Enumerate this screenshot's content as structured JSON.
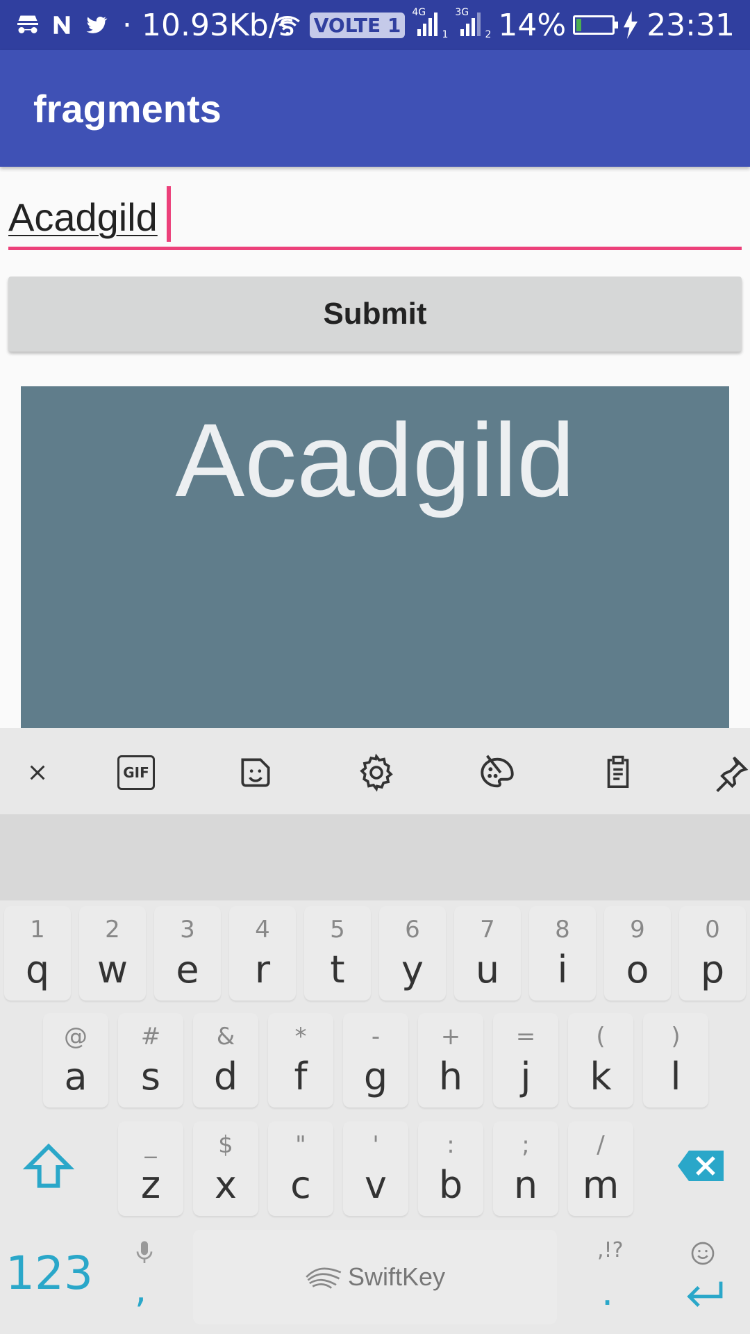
{
  "status_bar": {
    "speed": "10.93Kb/s",
    "volte": "VOLTE 1",
    "sim1_network": "4G",
    "sim1_index": "1",
    "sim2_network": "3G",
    "sim2_index": "2",
    "battery_percent": "14%",
    "battery_level": 0.14,
    "time": "23:31"
  },
  "app_bar": {
    "title": "fragments"
  },
  "input": {
    "value": "Acadgild"
  },
  "submit": {
    "label": "Submit"
  },
  "fragment": {
    "text": "Acadgild",
    "bg_color": "#607d8b"
  },
  "keyboard": {
    "toolbar_icons": [
      "close-icon",
      "gif-icon",
      "sticker-icon",
      "settings-icon",
      "theme-palette-icon",
      "clipboard-icon",
      "pin-icon"
    ],
    "gif_label": "GIF",
    "row1": [
      {
        "hint": "1",
        "key": "q"
      },
      {
        "hint": "2",
        "key": "w"
      },
      {
        "hint": "3",
        "key": "e"
      },
      {
        "hint": "4",
        "key": "r"
      },
      {
        "hint": "5",
        "key": "t"
      },
      {
        "hint": "6",
        "key": "y"
      },
      {
        "hint": "7",
        "key": "u"
      },
      {
        "hint": "8",
        "key": "i"
      },
      {
        "hint": "9",
        "key": "o"
      },
      {
        "hint": "0",
        "key": "p"
      }
    ],
    "row2": [
      {
        "hint": "@",
        "key": "a"
      },
      {
        "hint": "#",
        "key": "s"
      },
      {
        "hint": "&",
        "key": "d"
      },
      {
        "hint": "*",
        "key": "f"
      },
      {
        "hint": "-",
        "key": "g"
      },
      {
        "hint": "+",
        "key": "h"
      },
      {
        "hint": "=",
        "key": "j"
      },
      {
        "hint": "(",
        "key": "k"
      },
      {
        "hint": ")",
        "key": "l"
      }
    ],
    "row3": [
      {
        "hint": "_",
        "key": "z"
      },
      {
        "hint": "$",
        "key": "x"
      },
      {
        "hint": "\"",
        "key": "c"
      },
      {
        "hint": "'",
        "key": "v"
      },
      {
        "hint": ":",
        "key": "b"
      },
      {
        "hint": ";",
        "key": "n"
      },
      {
        "hint": "/",
        "key": "m"
      }
    ],
    "numbers_label": "123",
    "comma_key": ",",
    "space_label": "SwiftKey",
    "punct_hint": ",!?",
    "period_key": ".",
    "accent_color": "#2aa7c9"
  }
}
